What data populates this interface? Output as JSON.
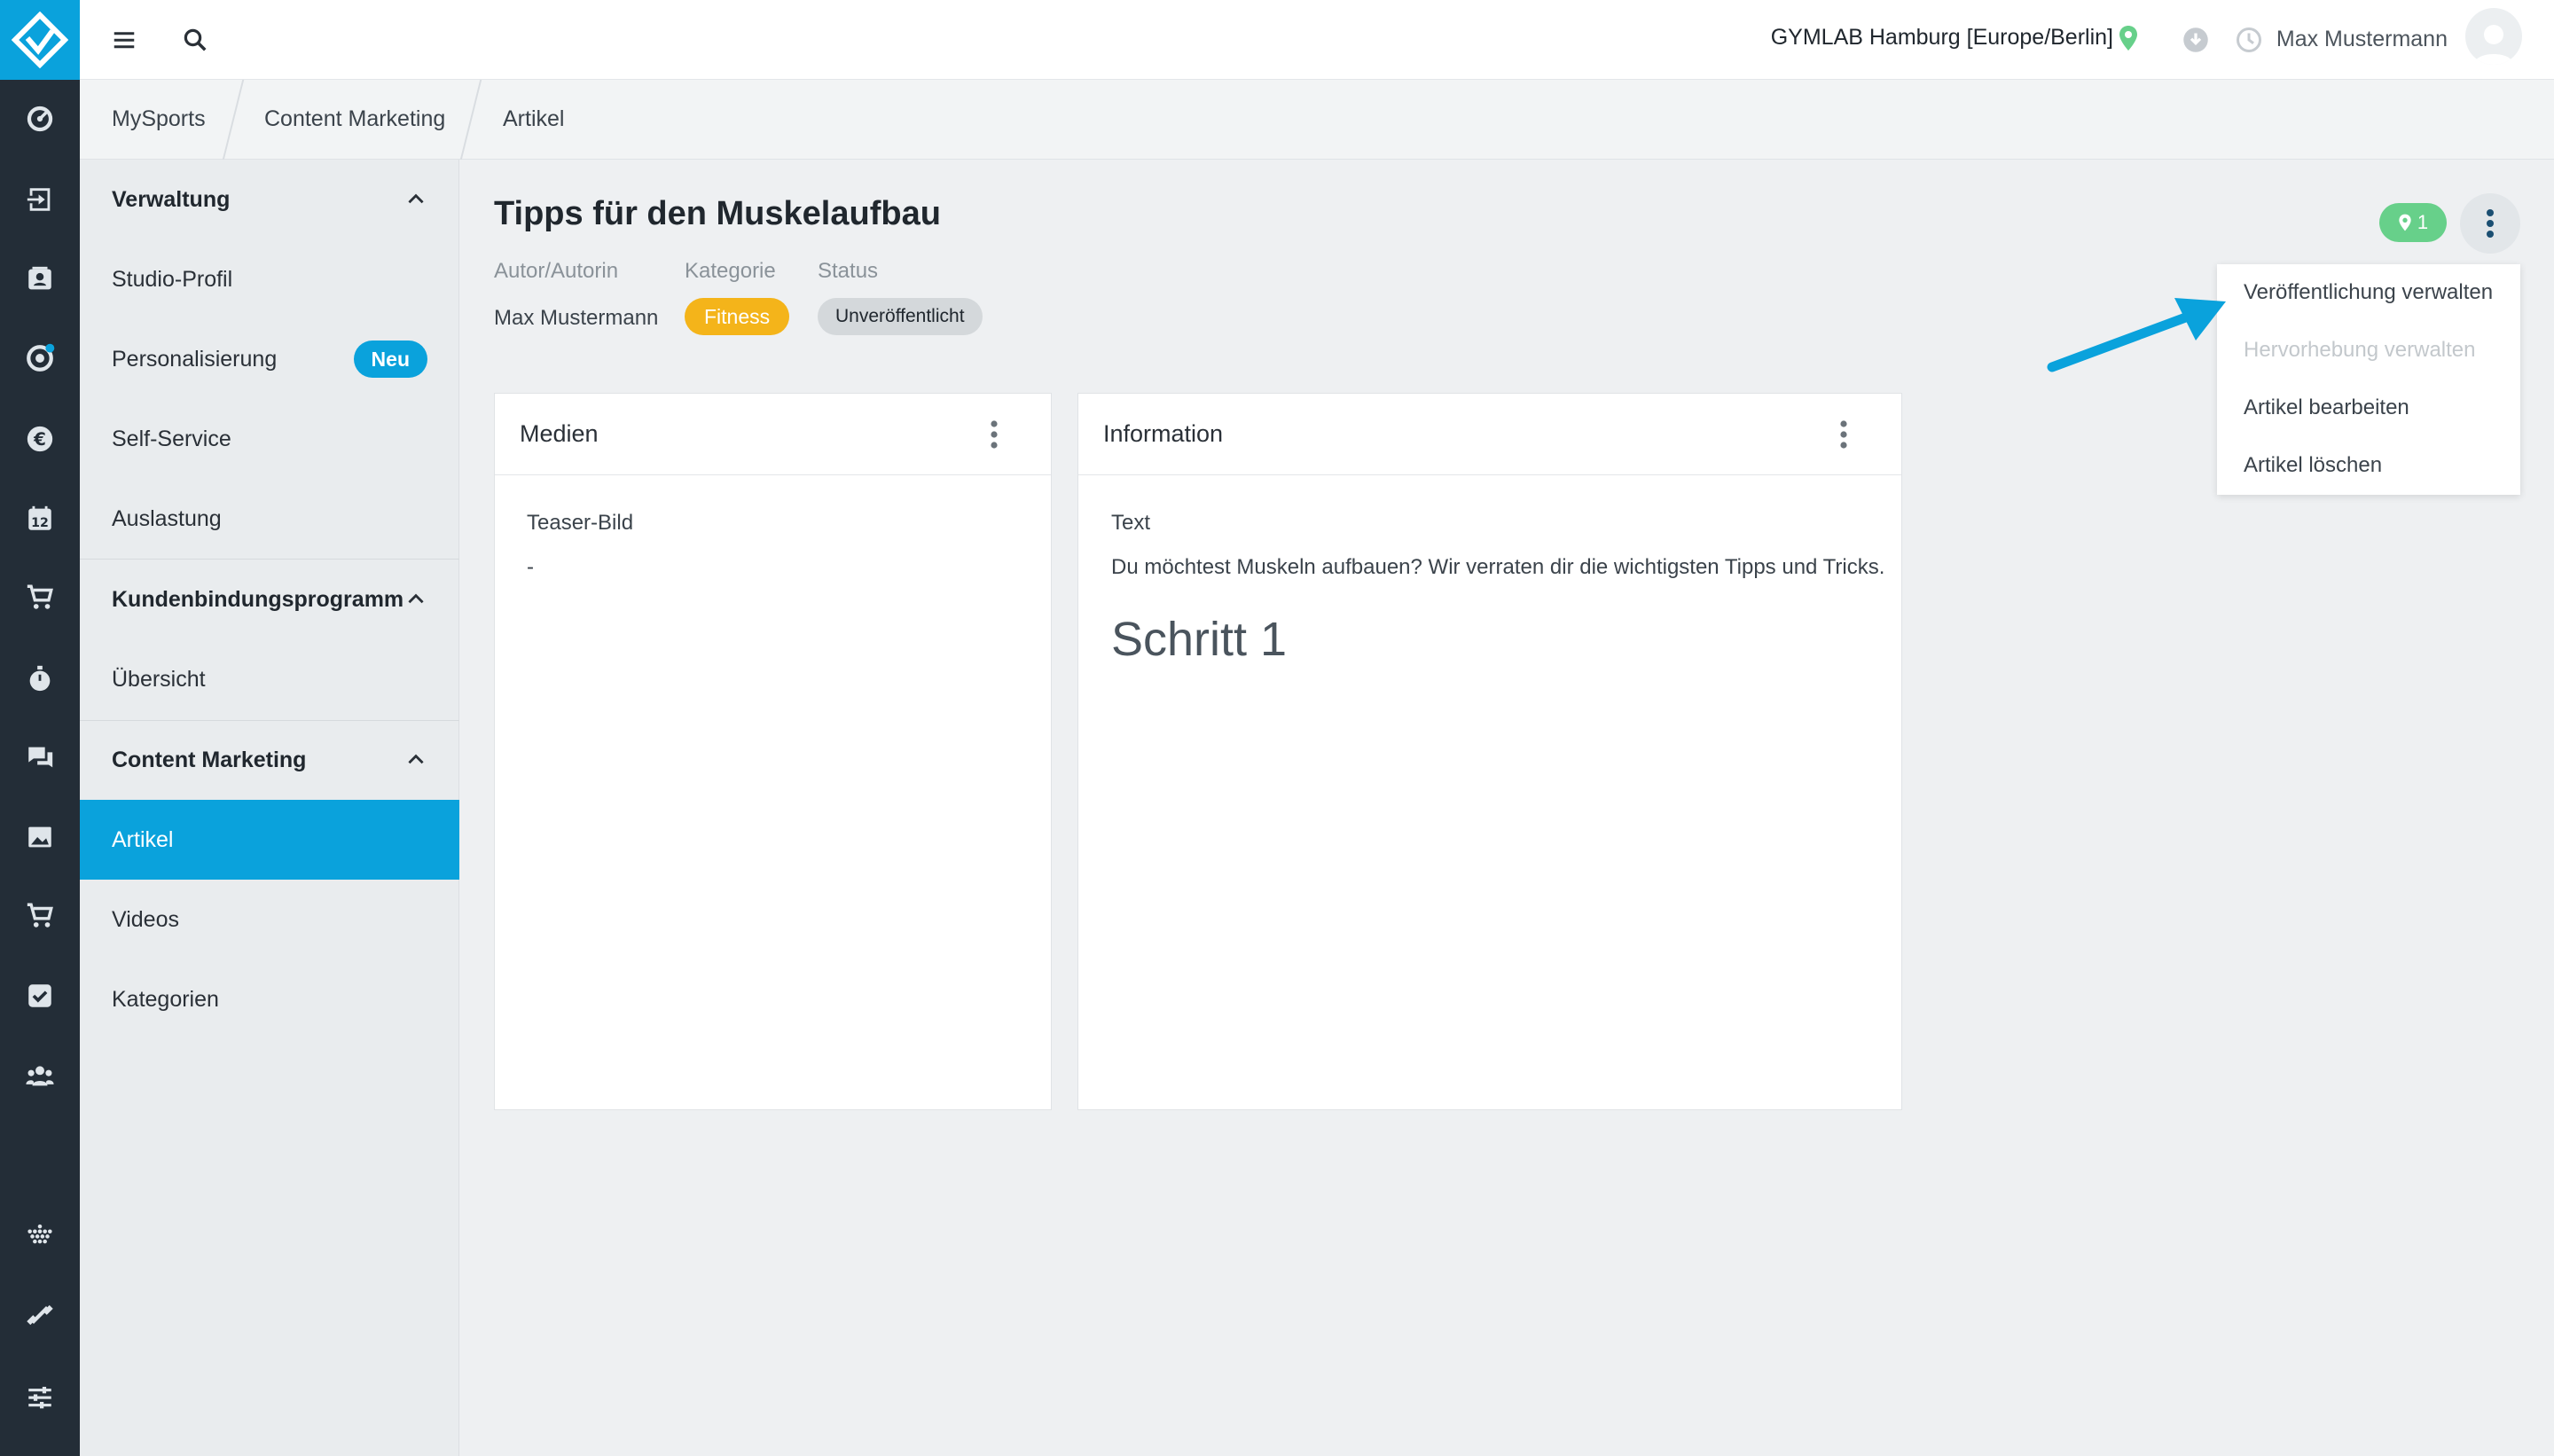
{
  "colors": {
    "accent": "#0aa2dc",
    "rail": "#232d37",
    "fitness": "#f4b41a",
    "location_badge": "#67d08a",
    "arrow": "#0aa2dc"
  },
  "rail": {
    "icons": [
      "dashboard-icon",
      "checkin-icon",
      "contacts-icon",
      "settings-cog-icon",
      "euro-icon",
      "calendar-icon",
      "cart-icon",
      "stopwatch-icon",
      "chat-icon",
      "image-icon",
      "cart-2-icon",
      "task-check-icon",
      "team-icon",
      "dots-grid-icon",
      "dumbbell-icon",
      "sliders-icon"
    ],
    "calendar_day": "12"
  },
  "topbar": {
    "studio": "GYMLAB Hamburg [Europe/Berlin]",
    "user": "Max Mustermann"
  },
  "breadcrumb": [
    "MySports",
    "Content Marketing",
    "Artikel"
  ],
  "sidebar": {
    "group1": "Verwaltung",
    "item_studio": "Studio-Profil",
    "item_personal": "Personalisierung",
    "badge_new": "Neu",
    "item_self": "Self-Service",
    "item_auslastung": "Auslastung",
    "group2": "Kundenbindungsprogramm",
    "item_uebersicht": "Übersicht",
    "group3": "Content Marketing",
    "item_artikel": "Artikel",
    "item_videos": "Videos",
    "item_kategorien": "Kategorien"
  },
  "article": {
    "title": "Tipps für den Muskelaufbau",
    "label_author": "Autor/Autorin",
    "label_category": "Kategorie",
    "label_status": "Status",
    "author": "Max Mustermann",
    "category": "Fitness",
    "status": "Unveröffentlicht",
    "location_count": "1"
  },
  "menu": {
    "item1": "Veröffentlichung verwalten",
    "item2": "Hervorhebung verwalten",
    "item3": "Artikel bearbeiten",
    "item4": "Artikel löschen"
  },
  "media_card": {
    "title": "Medien",
    "label": "Teaser-Bild",
    "value": "-"
  },
  "info_card": {
    "title": "Information",
    "label": "Text",
    "text": "Du möchtest Muskeln aufbauen? Wir verraten dir die wichtigsten Tipps und Tricks.",
    "heading": "Schritt 1"
  }
}
